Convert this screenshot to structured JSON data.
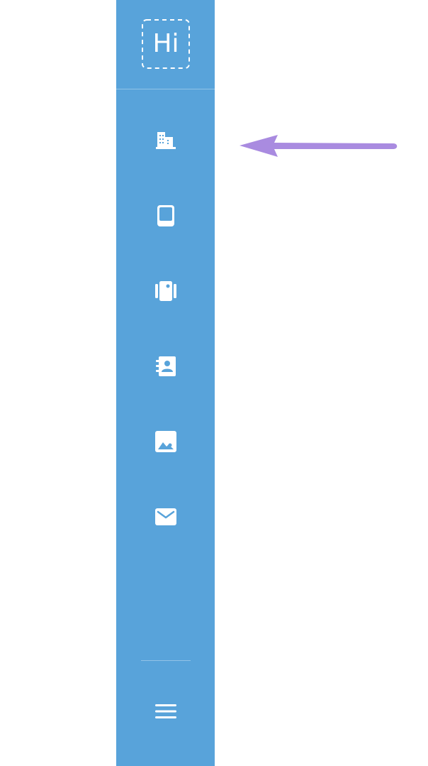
{
  "brand": {
    "logo_text": "Hi",
    "accent_color": "#58a3da"
  },
  "sidebar": {
    "items": [
      {
        "icon": "building-icon"
      },
      {
        "icon": "tablet-icon"
      },
      {
        "icon": "gallery-icon"
      },
      {
        "icon": "contacts-icon"
      },
      {
        "icon": "image-icon"
      },
      {
        "icon": "mail-icon"
      }
    ],
    "menu_icon": "hamburger-menu-icon"
  },
  "annotation": {
    "arrow_color": "#a98be0",
    "points_to": "building-icon"
  }
}
